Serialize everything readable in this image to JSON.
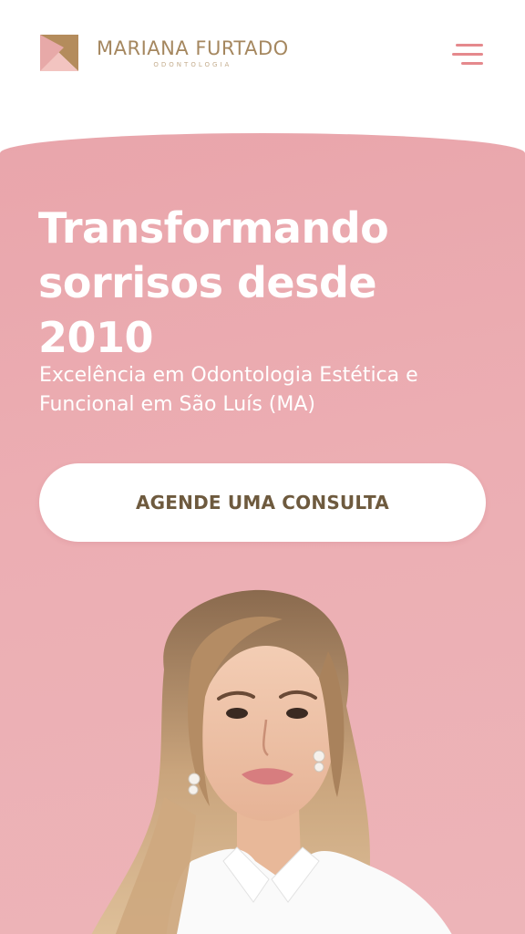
{
  "header": {
    "brand_name": "MARIANA FURTADO",
    "brand_subtitle": "ODONTOLOGIA",
    "menu_icon": "hamburger-menu-icon"
  },
  "hero": {
    "title": "Transformando sorrisos desde 2010",
    "subtitle": "Excelência em Odontologia Estética e Funcional em São Luís (MA)",
    "cta_label": "AGENDE UMA CONSULTA",
    "image": "dentist-portrait"
  },
  "colors": {
    "hero_pink": "#ECACB1",
    "brand_gold": "#A5875F",
    "cta_text": "#6E5A3E",
    "menu_accent": "#E5898D",
    "white": "#FFFFFF"
  }
}
